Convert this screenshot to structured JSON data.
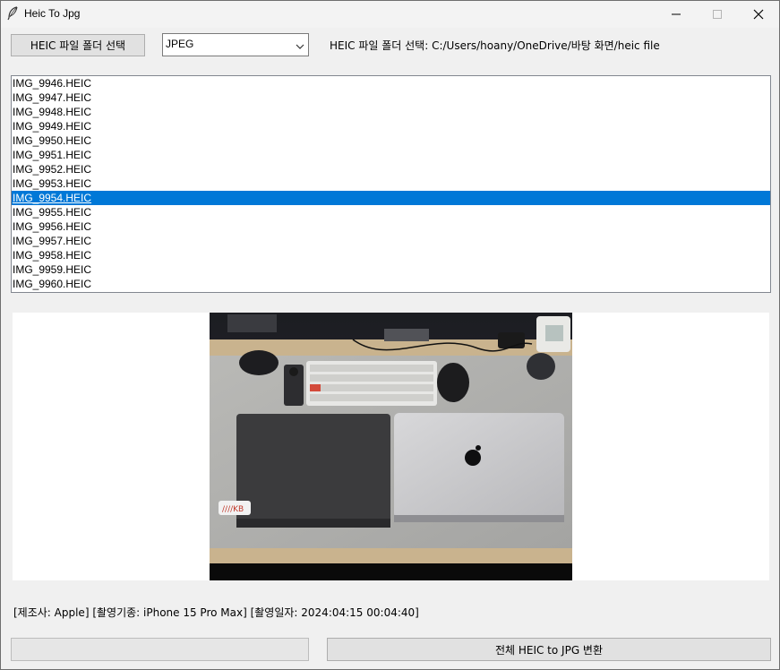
{
  "window": {
    "title": "Heic To Jpg"
  },
  "toolbar": {
    "select_folder_label": "HEIC 파일 폴더 선택",
    "format_value": "JPEG",
    "path_text": "HEIC 파일 폴더 선택: C:/Users/hoany/OneDrive/바탕 화면/heic file"
  },
  "files": [
    "IMG_9946.HEIC",
    "IMG_9947.HEIC",
    "IMG_9948.HEIC",
    "IMG_9949.HEIC",
    "IMG_9950.HEIC",
    "IMG_9951.HEIC",
    "IMG_9952.HEIC",
    "IMG_9953.HEIC",
    "IMG_9954.HEIC",
    "IMG_9955.HEIC",
    "IMG_9956.HEIC",
    "IMG_9957.HEIC",
    "IMG_9958.HEIC",
    "IMG_9959.HEIC",
    "IMG_9960.HEIC"
  ],
  "selected_file": "IMG_9954.HEIC",
  "exif_text": "[제조사: Apple] [촬영기종: iPhone 15 Pro Max] [촬영일자: 2024:04:15 00:04:40]",
  "progress": {
    "value": 0
  },
  "convert_button_label": "전체 HEIC to JPG 변환",
  "colors": {
    "selection": "#0078d7",
    "window_bg": "#f0f0f0"
  }
}
